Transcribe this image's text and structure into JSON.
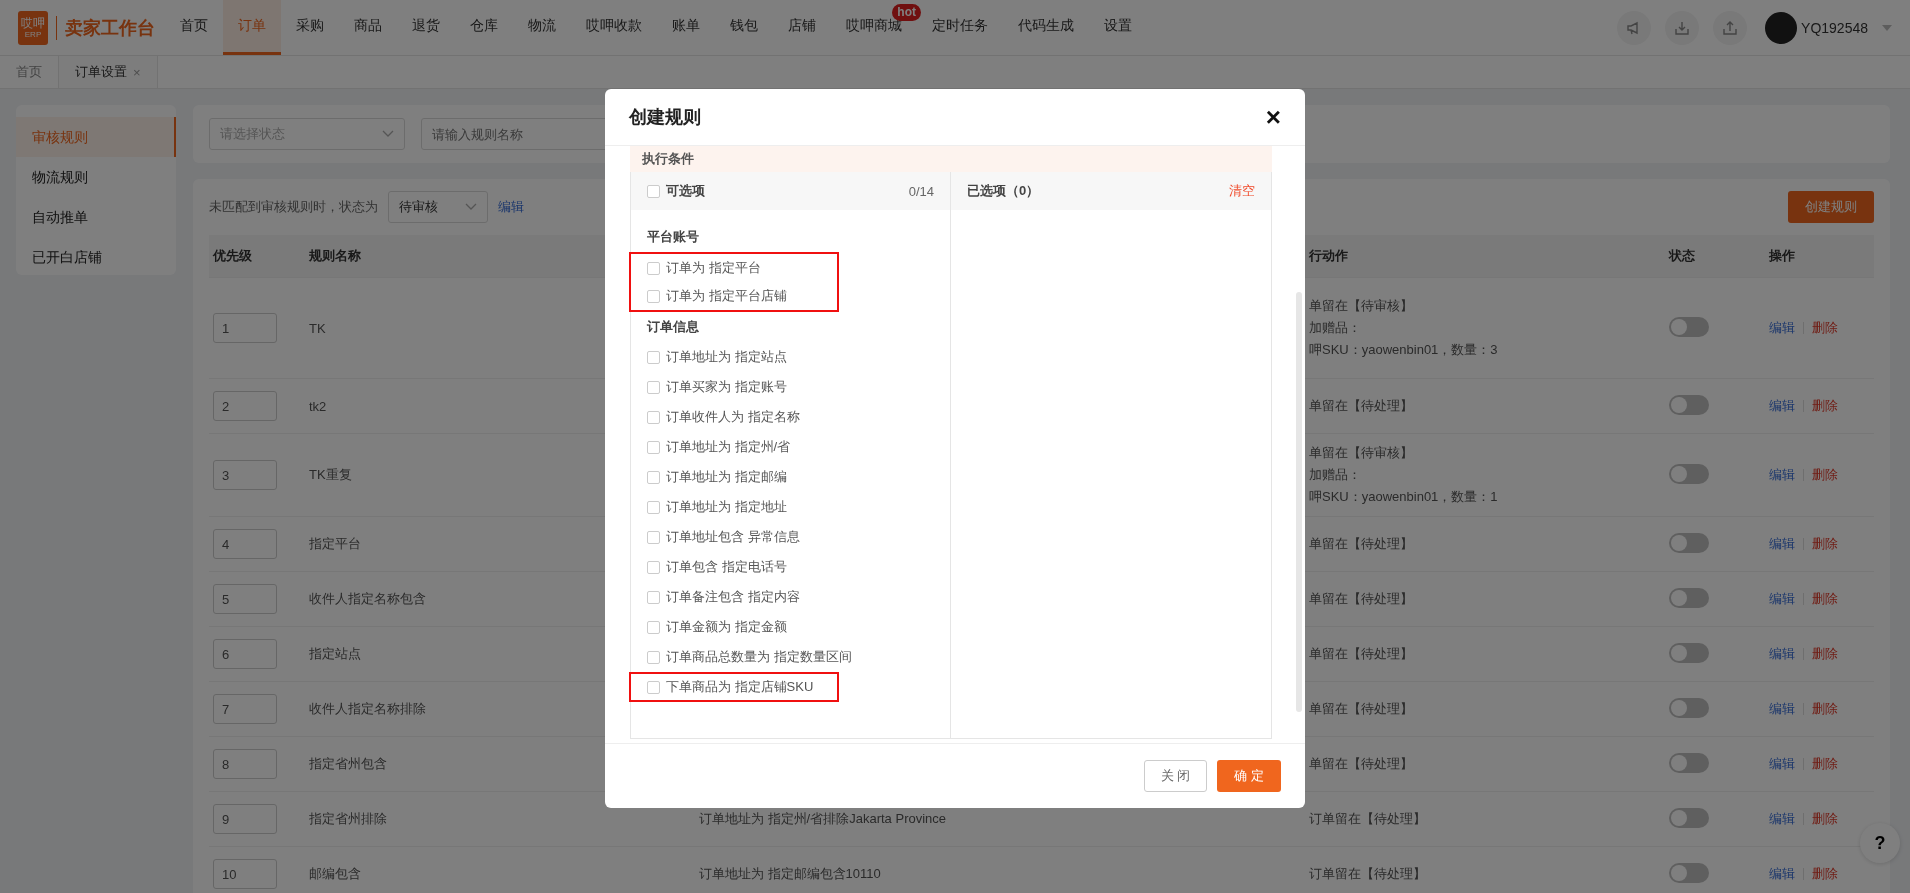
{
  "nav": {
    "logo": {
      "mark": "哎呷",
      "sub": "ERP"
    },
    "title": "卖家工作台",
    "items": [
      {
        "label": "首页",
        "selected": false
      },
      {
        "label": "订单",
        "selected": true
      },
      {
        "label": "采购",
        "selected": false
      },
      {
        "label": "商品",
        "selected": false
      },
      {
        "label": "退货",
        "selected": false
      },
      {
        "label": "仓库",
        "selected": false
      },
      {
        "label": "物流",
        "selected": false
      },
      {
        "label": "哎呷收款",
        "selected": false
      },
      {
        "label": "账单",
        "selected": false
      },
      {
        "label": "钱包",
        "selected": false
      },
      {
        "label": "店铺",
        "selected": false
      },
      {
        "label": "哎呷商城",
        "selected": false,
        "badge": "hot"
      },
      {
        "label": "定时任务",
        "selected": false
      },
      {
        "label": "代码生成",
        "selected": false
      },
      {
        "label": "设置",
        "selected": false
      }
    ],
    "user": {
      "name": "YQ192548"
    }
  },
  "tabs": [
    {
      "label": "首页",
      "selected": false
    },
    {
      "label": "订单设置",
      "selected": true,
      "close": "×"
    }
  ],
  "sidebar": {
    "items": [
      {
        "label": "审核规则",
        "selected": true
      },
      {
        "label": "物流规则",
        "selected": false
      },
      {
        "label": "自动推单",
        "selected": false
      },
      {
        "label": "已开白店铺",
        "selected": false
      }
    ]
  },
  "filters": {
    "status_select": {
      "placeholder": "请选择状态"
    },
    "name_input": {
      "placeholder": "请输入规则名称"
    }
  },
  "default_status": {
    "label": "未匹配到审核规则时，状态为",
    "value": "待审核",
    "edit": "编辑"
  },
  "create_button": "创建规则",
  "table": {
    "columns": {
      "priority": "优先级",
      "name": "规则名称",
      "action": "行动作",
      "status": "状态",
      "operations": "操作"
    },
    "rows": [
      {
        "priority": "1",
        "name": "TK",
        "action": [
          "单留在【待审核】",
          "加赠品：",
          "呷SKU：yaowenbin01，数量：3"
        ],
        "on": false,
        "edit": "编辑",
        "delete": "删除"
      },
      {
        "priority": "2",
        "name": "tk2",
        "action": [
          "单留在【待处理】"
        ],
        "on": false,
        "edit": "编辑",
        "delete": "删除"
      },
      {
        "priority": "3",
        "name": "TK重复",
        "action": [
          "单留在【待审核】",
          "加赠品：",
          "呷SKU：yaowenbin01，数量：1"
        ],
        "on": false,
        "edit": "编辑",
        "delete": "删除"
      },
      {
        "priority": "4",
        "name": "指定平台",
        "action": [
          "单留在【待处理】"
        ],
        "on": false,
        "edit": "编辑",
        "delete": "删除"
      },
      {
        "priority": "5",
        "name": "收件人指定名称包含",
        "action": [
          "单留在【待处理】"
        ],
        "on": false,
        "edit": "编辑",
        "delete": "删除"
      },
      {
        "priority": "6",
        "name": "指定站点",
        "action": [
          "单留在【待处理】"
        ],
        "on": false,
        "edit": "编辑",
        "delete": "删除"
      },
      {
        "priority": "7",
        "name": "收件人指定名称排除",
        "action": [
          "单留在【待处理】"
        ],
        "on": false,
        "edit": "编辑",
        "delete": "删除"
      },
      {
        "priority": "8",
        "name": "指定省州包含",
        "action": [
          "单留在【待处理】"
        ],
        "on": false,
        "edit": "编辑",
        "delete": "删除"
      },
      {
        "priority": "9",
        "name": "指定省州排除",
        "condition": "订单地址为 指定州/省排除Jakarta Province",
        "action": [
          "订单留在【待处理】"
        ],
        "on": false,
        "edit": "编辑",
        "delete": "删除"
      },
      {
        "priority": "10",
        "name": "邮编包含",
        "condition": "订单地址为 指定邮编包含10110",
        "action": [
          "订单留在【待处理】"
        ],
        "on": false,
        "edit": "编辑",
        "delete": "删除"
      }
    ]
  },
  "modal": {
    "title": "创建规则",
    "close": "×",
    "section": "执行条件",
    "source": {
      "label": "可选项",
      "checked": false,
      "count": "0/14"
    },
    "target": {
      "label": "已选项（0）",
      "clear": "清空"
    },
    "groups": [
      {
        "title": "平台账号",
        "items": [
          {
            "label": "订单为 指定平台",
            "checked": false,
            "highlighted": true
          },
          {
            "label": "订单为 指定平台店铺",
            "checked": false,
            "highlighted": true
          }
        ]
      },
      {
        "title": "订单信息",
        "items": [
          {
            "label": "订单地址为 指定站点",
            "checked": false,
            "highlighted": false
          },
          {
            "label": "订单买家为 指定账号",
            "checked": false,
            "highlighted": false
          },
          {
            "label": "订单收件人为 指定名称",
            "checked": false,
            "highlighted": false
          },
          {
            "label": "订单地址为 指定州/省",
            "checked": false,
            "highlighted": false
          },
          {
            "label": "订单地址为 指定邮编",
            "checked": false,
            "highlighted": false
          },
          {
            "label": "订单地址为 指定地址",
            "checked": false,
            "highlighted": false
          },
          {
            "label": "订单地址包含 异常信息",
            "checked": false,
            "highlighted": false
          },
          {
            "label": "订单包含 指定电话号",
            "checked": false,
            "highlighted": false
          },
          {
            "label": "订单备注包含 指定内容",
            "checked": false,
            "highlighted": false
          },
          {
            "label": "订单金额为 指定金额",
            "checked": false,
            "highlighted": false
          },
          {
            "label": "订单商品总数量为 指定数量区间",
            "checked": false,
            "highlighted": false
          },
          {
            "label": "下单商品为 指定店铺SKU",
            "checked": false,
            "highlighted": true
          }
        ]
      }
    ],
    "buttons": {
      "cancel": "关 闭",
      "confirm": "确 定"
    }
  },
  "help": "?"
}
